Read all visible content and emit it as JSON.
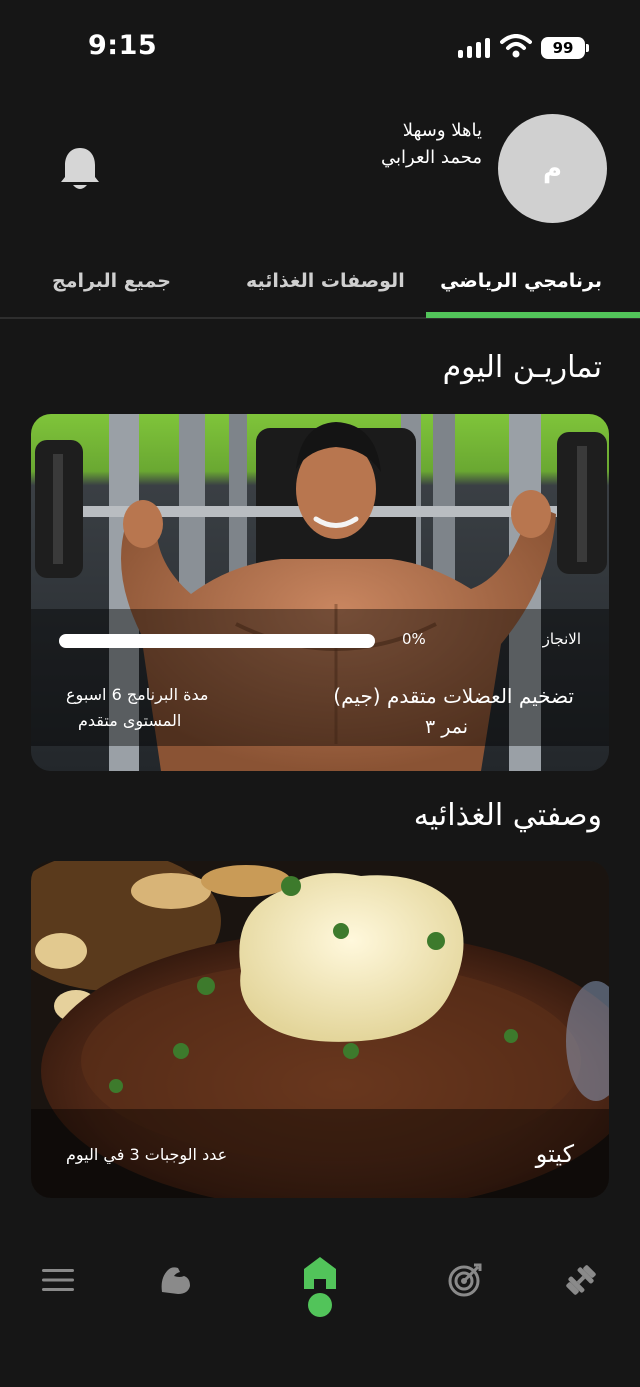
{
  "status_bar": {
    "time": "9:15",
    "battery": "99"
  },
  "header": {
    "greeting": "ياهلا وسهلا",
    "user_name": "محمد العرابي",
    "avatar_initial": "م"
  },
  "tabs": [
    {
      "label": "برنامجي الرياضي",
      "active": true
    },
    {
      "label": "الوصفات الغذائيه",
      "active": false
    },
    {
      "label": "جميع البرامج",
      "active": false
    }
  ],
  "workout_section": {
    "title": "تماريـن اليوم",
    "card": {
      "progress_label": "الانجاز",
      "progress_value": "0%",
      "progress_fraction": 0,
      "program_name": "تضخيم العضلات متقدم (جيم)",
      "coach_name": "نمر ٣",
      "duration": "مدة البرنامج 6 اسبوع",
      "level": "المستوى متقدم"
    }
  },
  "meal_section": {
    "title": "وصفتي الغذائيه",
    "card": {
      "diet_name": "كيتو",
      "meals_per_day": "عدد الوجبات 3 في اليوم"
    }
  },
  "bottom_nav": [
    {
      "icon": "menu-icon"
    },
    {
      "icon": "flexed-arm-icon"
    },
    {
      "icon": "home-icon",
      "active": true
    },
    {
      "icon": "target-icon"
    },
    {
      "icon": "dumbbell-icon"
    }
  ],
  "colors": {
    "accent": "#52c45a",
    "background": "#161616"
  }
}
